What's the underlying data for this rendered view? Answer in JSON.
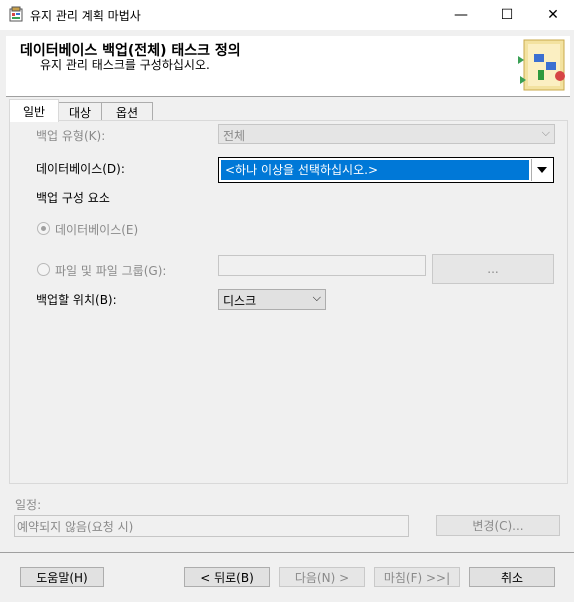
{
  "window": {
    "title": "유지 관리 계획 마법사",
    "minimize": "—",
    "maximize": "☐",
    "close": "✕"
  },
  "header": {
    "title": "데이터베이스 백업(전체) 태스크 정의",
    "subtitle": "유지 관리 태스크를 구성하십시오."
  },
  "tabs": [
    {
      "label": "일반"
    },
    {
      "label": "대상"
    },
    {
      "label": "옵션"
    }
  ],
  "general": {
    "backup_type_label": "백업 유형(K):",
    "backup_type_value": "전체",
    "database_label": "데이터베이스(D):",
    "database_value": "<하나 이상을 선택하십시오.>",
    "component_label": "백업 구성 요소",
    "radio_database": "데이터베이스(E)",
    "radio_files": "파일 및 파일 그룹(G):",
    "files_value": "",
    "browse_button": "...",
    "destination_label": "백업할 위치(B):",
    "destination_value": "디스크"
  },
  "schedule": {
    "label": "일정:",
    "value": "예약되지 않음(요청 시)",
    "change_button": "변경(C)..."
  },
  "footer": {
    "help": "도움말(H)",
    "back": "< 뒤로(B)",
    "next": "다음(N) >",
    "finish": "마침(F) >>|",
    "cancel": "취소"
  },
  "colors": {
    "selection": "#0078d7",
    "disabled_text": "#8a8a8a"
  }
}
